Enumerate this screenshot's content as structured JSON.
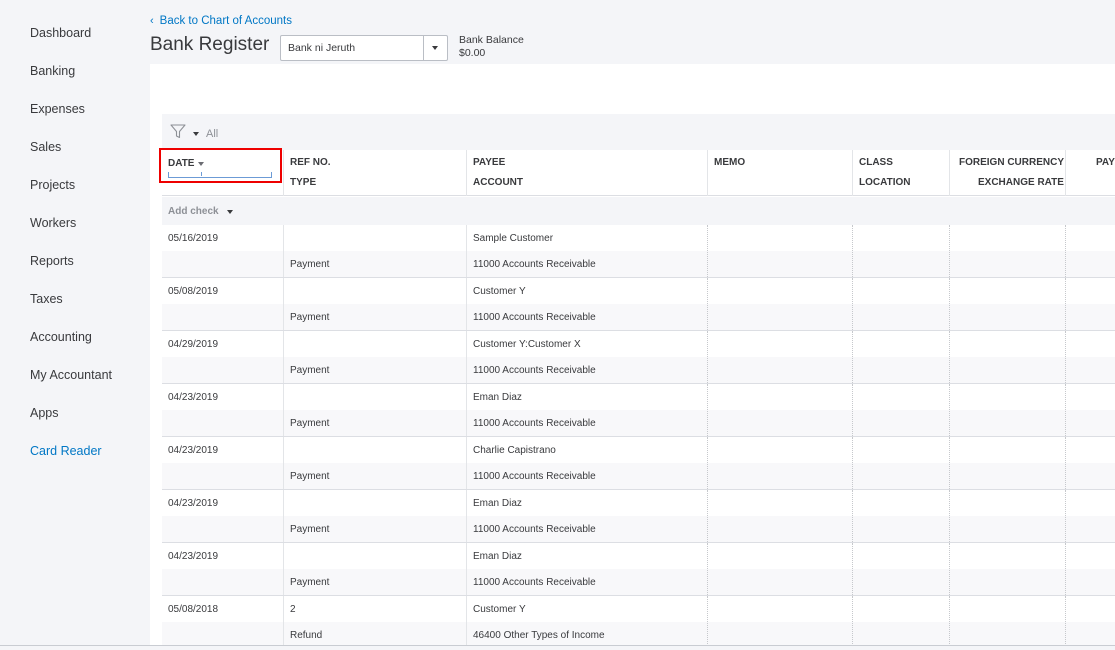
{
  "sidebar": {
    "items": [
      {
        "label": "Dashboard"
      },
      {
        "label": "Banking"
      },
      {
        "label": "Expenses"
      },
      {
        "label": "Sales"
      },
      {
        "label": "Projects"
      },
      {
        "label": "Workers"
      },
      {
        "label": "Reports"
      },
      {
        "label": "Taxes"
      },
      {
        "label": "Accounting"
      },
      {
        "label": "My Accountant"
      },
      {
        "label": "Apps"
      },
      {
        "label": "Card Reader"
      }
    ]
  },
  "header": {
    "back_link": "Back to Chart of Accounts",
    "title": "Bank Register",
    "account_select": {
      "value": "Bank ni Jeruth",
      "icon": "chevron-down-icon"
    },
    "balance_label": "Bank Balance",
    "balance_value": "$0.00"
  },
  "filter": {
    "label": "All",
    "icon": "funnel-icon"
  },
  "columns": {
    "date": "DATE",
    "ref_no": "REF NO.",
    "type": "TYPE",
    "payee": "PAYEE",
    "account": "ACCOUNT",
    "memo": "MEMO",
    "class": "CLASS",
    "location": "LOCATION",
    "foreign_currency": "FOREIGN CURRENCY",
    "exchange_rate": "EXCHANGE RATE",
    "payment_partial": "PAY"
  },
  "add_check": {
    "label": "Add check"
  },
  "transactions": [
    {
      "date": "05/16/2019",
      "ref": "",
      "type": "Payment",
      "payee": "Sample Customer",
      "account": "11000 Accounts Receivable"
    },
    {
      "date": "05/08/2019",
      "ref": "",
      "type": "Payment",
      "payee": "Customer Y",
      "account": "11000 Accounts Receivable"
    },
    {
      "date": "04/29/2019",
      "ref": "",
      "type": "Payment",
      "payee": "Customer Y:Customer X",
      "account": "11000 Accounts Receivable"
    },
    {
      "date": "04/23/2019",
      "ref": "",
      "type": "Payment",
      "payee": "Eman Diaz",
      "account": "11000 Accounts Receivable"
    },
    {
      "date": "04/23/2019",
      "ref": "",
      "type": "Payment",
      "payee": "Charlie Capistrano",
      "account": "11000 Accounts Receivable"
    },
    {
      "date": "04/23/2019",
      "ref": "",
      "type": "Payment",
      "payee": "Eman Diaz",
      "account": "11000 Accounts Receivable"
    },
    {
      "date": "04/23/2019",
      "ref": "",
      "type": "Payment",
      "payee": "Eman Diaz",
      "account": "11000 Accounts Receivable"
    },
    {
      "date": "05/08/2018",
      "ref": "2",
      "type": "Refund",
      "payee": "Customer Y",
      "account": "46400 Other Types of Income"
    }
  ],
  "colors": {
    "accent": "#0077c5",
    "highlight": "#e00000",
    "text": "#393a3d"
  }
}
